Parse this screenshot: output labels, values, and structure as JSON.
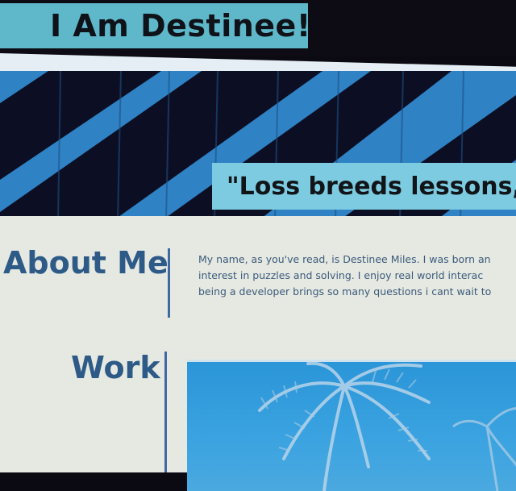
{
  "header": {
    "title": "I Am Destinee!"
  },
  "hero": {
    "quote": "\"Loss breeds lessons, l"
  },
  "about": {
    "heading": "About Me",
    "lines": [
      "My name, as you've read, is Destinee Miles. I was born an",
      "interest in puzzles and solving. I enjoy real world interac",
      "being a developer brings so many questions i cant wait to"
    ]
  },
  "work": {
    "heading": "Work",
    "image": "palm-trees-photo"
  },
  "colors": {
    "title_bg": "#5fb8c9",
    "quote_bg": "#7ccbe0",
    "heading": "#2d5a86",
    "body_text": "#3b5a7a",
    "page_bg": "#e6e9e2",
    "hero_blue": "#2f82c4",
    "hero_dark": "#0c0f24"
  }
}
